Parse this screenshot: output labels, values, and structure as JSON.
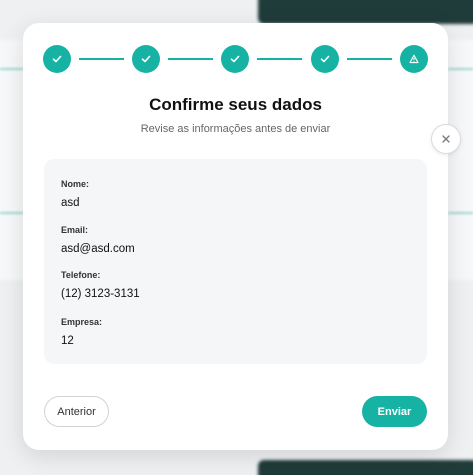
{
  "modal": {
    "title": "Confirme seus dados",
    "subtitle": "Revise as informações antes de enviar",
    "steps": [
      {
        "status": "complete",
        "icon": "check-icon"
      },
      {
        "status": "complete",
        "icon": "check-icon"
      },
      {
        "status": "complete",
        "icon": "check-icon"
      },
      {
        "status": "complete",
        "icon": "check-icon"
      },
      {
        "status": "current",
        "icon": "warning-icon"
      }
    ],
    "fields": [
      {
        "label": "Nome:",
        "value": "asd"
      },
      {
        "label": "Email:",
        "value": "asd@asd.com"
      },
      {
        "label": "Telefone:",
        "value": "(12) 3123-3131"
      },
      {
        "label": "Empresa:",
        "value": "12"
      }
    ],
    "prev_label": "Anterior",
    "send_label": "Enviar",
    "close_icon": "close-icon"
  },
  "colors": {
    "accent": "#16b3a4",
    "summary_bg": "#f5f6f8"
  }
}
